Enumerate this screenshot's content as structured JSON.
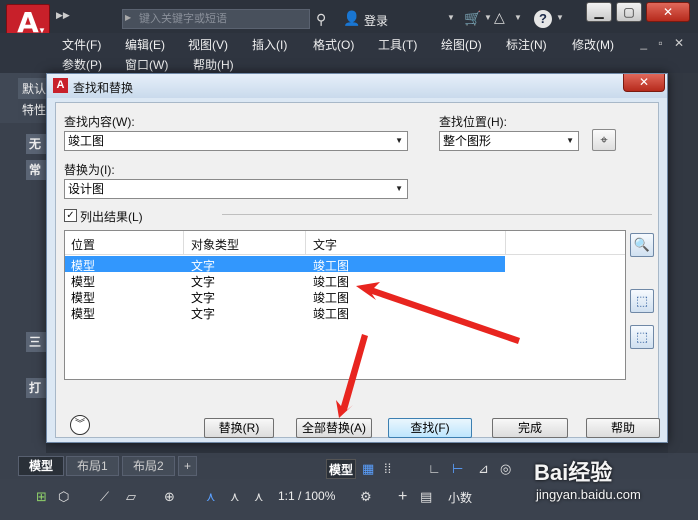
{
  "titlebar": {
    "logo_letter": "A",
    "search_placeholder": "键入关键字或短语",
    "login": "登录"
  },
  "menubar": {
    "row1": [
      "文件(F)",
      "编辑(E)",
      "视图(V)",
      "插入(I)",
      "格式(O)",
      "工具(T)",
      "绘图(D)",
      "标注(N)",
      "修改(M)"
    ],
    "row2": [
      "参数(P)",
      "窗口(W)",
      "帮助(H)"
    ]
  },
  "background": {
    "tab_default": "默认",
    "tab_props": "特性",
    "left_labels": [
      "无",
      "常",
      "三",
      "打"
    ]
  },
  "dialog": {
    "title": "查找和替换",
    "find_label": "查找内容(W):",
    "find_value": "竣工图",
    "where_label": "查找位置(H):",
    "where_value": "整个图形",
    "replace_label": "替换为(I):",
    "replace_value": "设计图",
    "list_results_label": "列出结果(L)",
    "list_results_checked": true,
    "columns": [
      "位置",
      "对象类型",
      "文字"
    ],
    "rows": [
      {
        "location": "模型",
        "type": "文字",
        "text": "竣工图",
        "selected": true
      },
      {
        "location": "模型",
        "type": "文字",
        "text": "竣工图",
        "selected": false
      },
      {
        "location": "模型",
        "type": "文字",
        "text": "竣工图",
        "selected": false
      },
      {
        "location": "模型",
        "type": "文字",
        "text": "竣工图",
        "selected": false
      }
    ],
    "buttons": {
      "replace": "替换(R)",
      "replace_all": "全部替换(A)",
      "find": "查找(F)",
      "done": "完成",
      "help": "帮助"
    }
  },
  "layout_tabs": [
    "模型",
    "布局1",
    "布局2",
    "+"
  ],
  "statusbar": {
    "model": "模型",
    "scale": "1:1 / 100%",
    "units": "小数"
  },
  "watermark": {
    "text": "Bai经验",
    "url": "jingyan.baidu.com"
  },
  "colors": {
    "selection": "#3297fd",
    "annotation_arrow": "#e8251f",
    "brand_red": "#c8202a"
  }
}
